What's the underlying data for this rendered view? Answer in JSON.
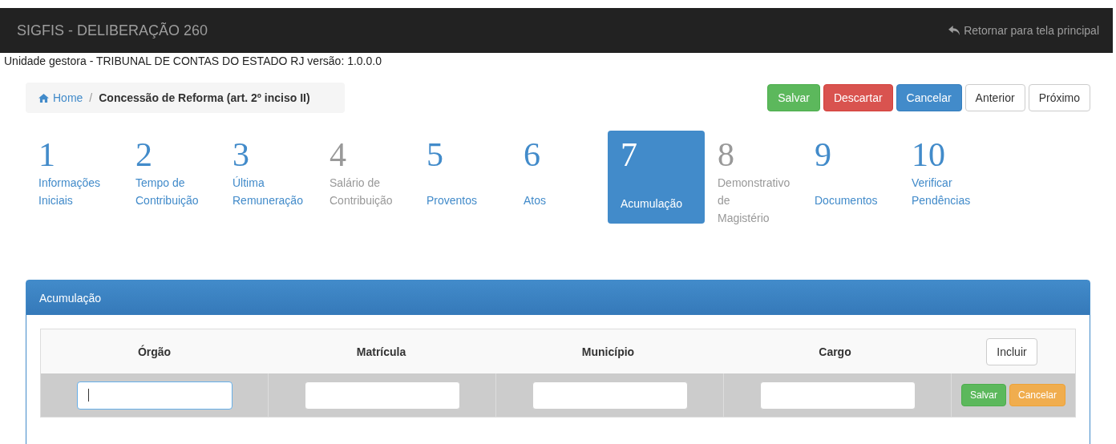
{
  "navbar": {
    "title": "SIGFIS - DELIBERAÇÃO 260",
    "return_link": "Retornar para tela principal"
  },
  "info_line": "Unidade gestora - TRIBUNAL DE CONTAS DO ESTADO RJ versão: 1.0.0.0",
  "breadcrumb": {
    "home": "Home",
    "separator": "/",
    "current": "Concessão de Reforma (art. 2º inciso II)"
  },
  "actions": [
    {
      "label": "Salvar",
      "kind": "success"
    },
    {
      "label": "Descartar",
      "kind": "danger"
    },
    {
      "label": "Cancelar",
      "kind": "primary"
    },
    {
      "label": "Anterior",
      "kind": "default"
    },
    {
      "label": "Próximo",
      "kind": "default"
    }
  ],
  "steps": [
    {
      "number": "1",
      "lines": [
        "Informações",
        "Iniciais"
      ],
      "selected": false,
      "disabled": false
    },
    {
      "number": "2",
      "lines": [
        "Tempo de",
        "Contribuição"
      ],
      "selected": false,
      "disabled": false
    },
    {
      "number": "3",
      "lines": [
        "Última",
        "Remuneração"
      ],
      "selected": false,
      "disabled": false
    },
    {
      "number": "4",
      "lines": [
        "Salário de",
        "Contribuição"
      ],
      "selected": false,
      "disabled": true
    },
    {
      "number": "5",
      "lines": [
        "Proventos"
      ],
      "selected": false,
      "disabled": false
    },
    {
      "number": "6",
      "lines": [
        "Atos"
      ],
      "selected": false,
      "disabled": false
    },
    {
      "number": "7",
      "lines": [
        "Acumulação"
      ],
      "selected": true,
      "disabled": false
    },
    {
      "number": "8",
      "lines": [
        "Demonstrativo",
        "de",
        "Magistério"
      ],
      "selected": false,
      "disabled": true
    },
    {
      "number": "9",
      "lines": [
        "Documentos"
      ],
      "selected": false,
      "disabled": false
    },
    {
      "number": "10",
      "lines": [
        "Verificar",
        "Pendências"
      ],
      "selected": false,
      "disabled": false
    }
  ],
  "panel": {
    "title": "Acumulação",
    "table": {
      "columns": [
        "Órgão",
        "Matrícula",
        "Município",
        "Cargo"
      ],
      "add_button": "Incluir",
      "inputs": [
        {
          "focused": true
        },
        {
          "focused": false
        },
        {
          "focused": false
        },
        {
          "focused": false
        }
      ],
      "row_buttons": [
        {
          "label": "Salvar",
          "kind": "success"
        },
        {
          "label": "Cancelar",
          "kind": "warning"
        }
      ]
    }
  }
}
